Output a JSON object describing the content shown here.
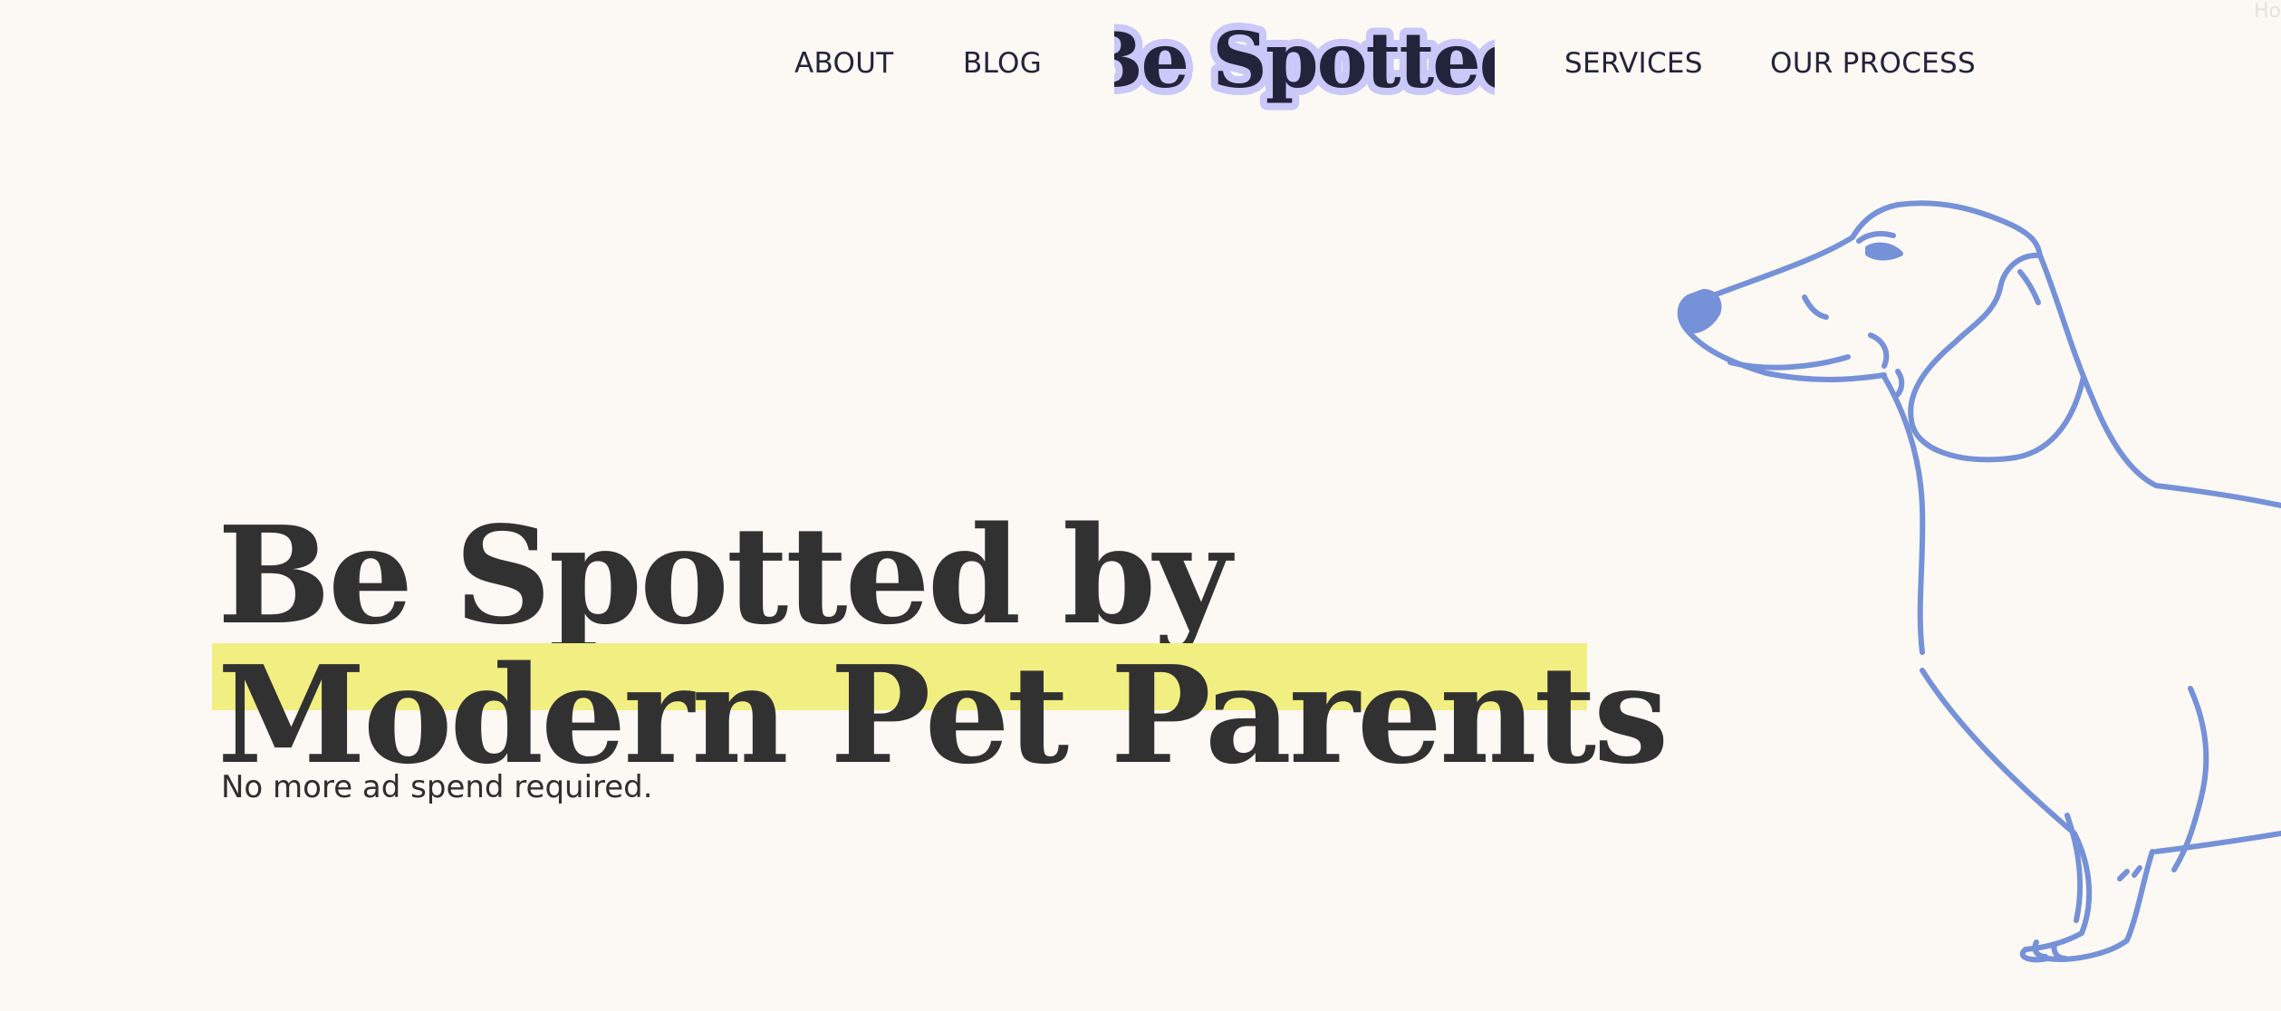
{
  "nav": {
    "about": "ABOUT",
    "blog": "BLOG",
    "services": "SERVICES",
    "our_process": "OUR PROCESS"
  },
  "logo": {
    "text": "Be Spotted",
    "fill_color": "#23233b",
    "outline_color": "#c9c8f8"
  },
  "corner_text": "Ho",
  "hero": {
    "line1": "Be Spotted by",
    "line2": "Modern Pet Parents",
    "subtitle": "No more ad spend required.",
    "highlight_color": "#f1ef82"
  },
  "illustration": {
    "icon": "dachshund-illustration",
    "color": "#7591d8"
  },
  "colors": {
    "background": "#fcf8f4",
    "text": "#313131"
  }
}
